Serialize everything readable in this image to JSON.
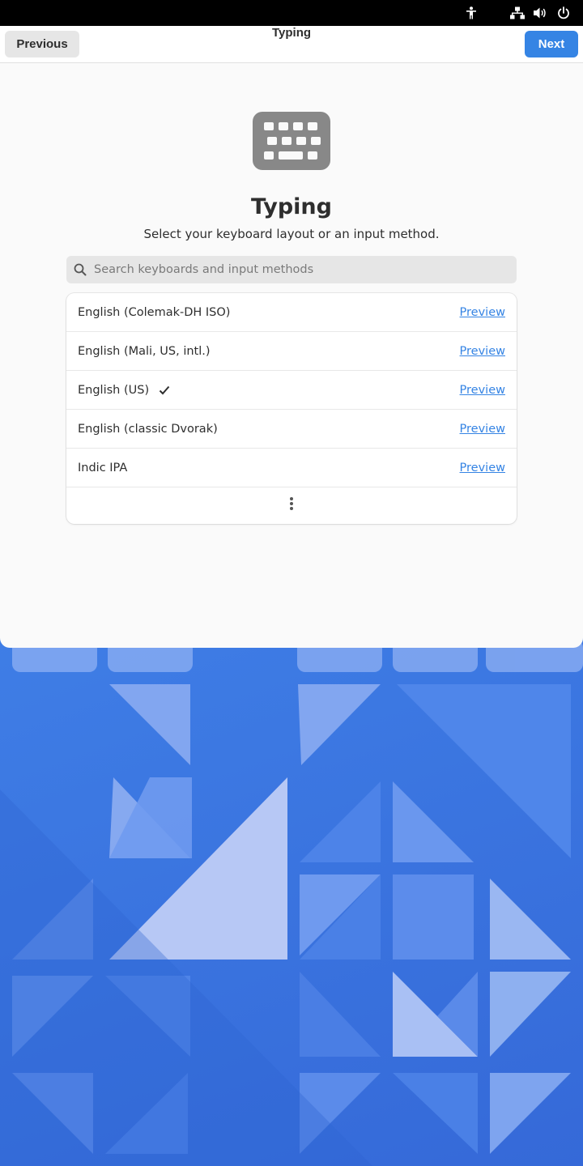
{
  "top_bar": {
    "icons": [
      "accessibility-icon",
      "network-wired-icon",
      "volume-icon",
      "power-icon"
    ]
  },
  "header": {
    "previous_label": "Previous",
    "title": "Typing",
    "next_label": "Next"
  },
  "main": {
    "icon": "keyboard-icon",
    "title": "Typing",
    "subtitle": "Select your keyboard layout or an input method.",
    "search": {
      "placeholder": "Search keyboards and input methods",
      "value": ""
    },
    "layouts": [
      {
        "name": "English (Colemak-DH ISO)",
        "selected": false,
        "preview_label": "Preview"
      },
      {
        "name": "English (Mali, US, intl.)",
        "selected": false,
        "preview_label": "Preview"
      },
      {
        "name": "English (US)",
        "selected": true,
        "preview_label": "Preview"
      },
      {
        "name": "English (classic Dvorak)",
        "selected": false,
        "preview_label": "Preview"
      },
      {
        "name": "Indic IPA",
        "selected": false,
        "preview_label": "Preview"
      }
    ],
    "more_icon": "view-more-icon"
  },
  "colors": {
    "accent": "#3584e4",
    "window_bg": "#fafafa",
    "top_bar_bg": "#000000"
  }
}
